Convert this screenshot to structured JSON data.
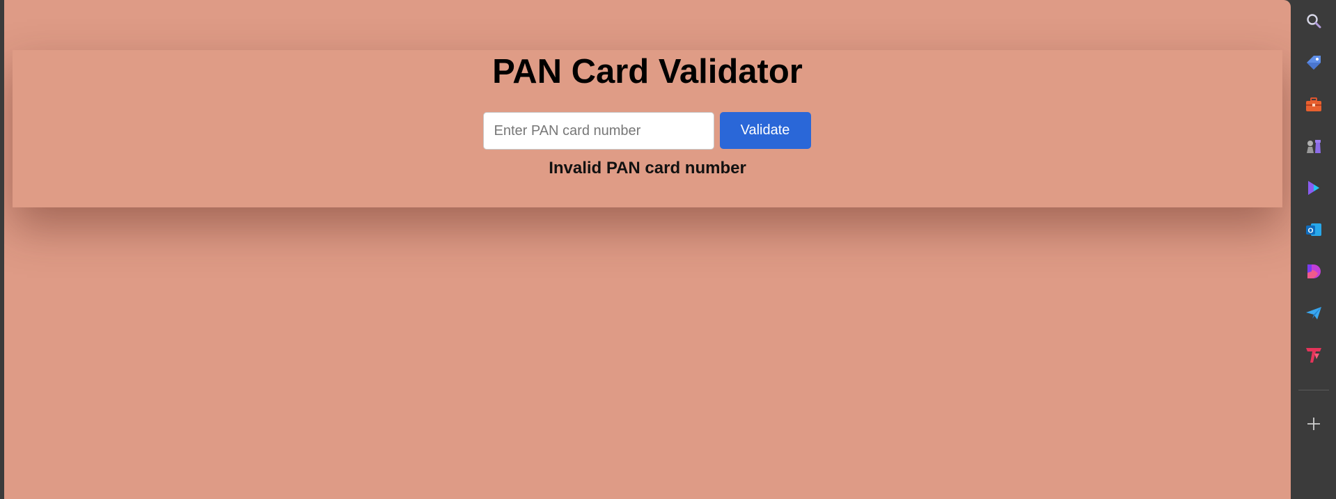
{
  "app": {
    "title": "PAN Card Validator"
  },
  "form": {
    "input_placeholder": "Enter PAN card number",
    "input_value": "",
    "validate_label": "Validate"
  },
  "result": {
    "message": "Invalid PAN card number"
  },
  "sidebar": {
    "icons": [
      "search-icon",
      "tag-icon",
      "toolbox-icon",
      "chess-pieces-icon",
      "copilot-icon",
      "outlook-icon",
      "designer-icon",
      "send-icon",
      "t-logo-icon",
      "add-icon"
    ]
  },
  "colors": {
    "page_background": "#de9b86",
    "button": "#2a67d8",
    "sidebar": "#3b3b3b"
  }
}
